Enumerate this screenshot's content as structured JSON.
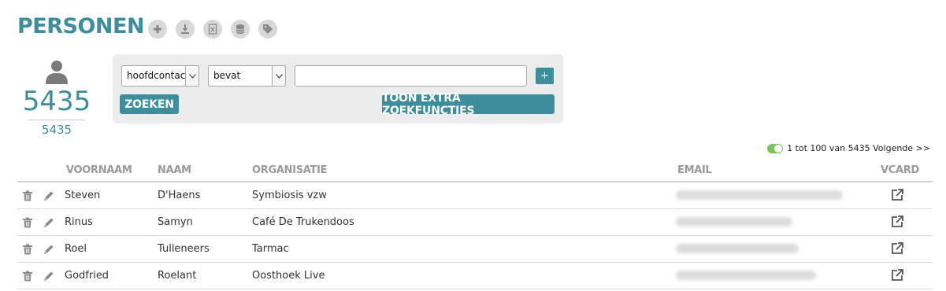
{
  "page": {
    "title": "PERSONEN"
  },
  "title_actions": [
    {
      "icon": "plus-icon"
    },
    {
      "icon": "download-icon"
    },
    {
      "icon": "excel-icon"
    },
    {
      "icon": "database-icon"
    },
    {
      "icon": "tag-icon"
    }
  ],
  "stats": {
    "icon": "person-icon",
    "total_large": "5435",
    "total_small": "5435"
  },
  "search": {
    "field_value": "hoofdcontac",
    "operator_value": "bevat",
    "input_value": "",
    "add_label": "+",
    "search_label": "ZOEKEN",
    "extra_label": "TOON EXTRA ZOEKFUNCTIES"
  },
  "pagination": {
    "text": "1 tot 100 van 5435 Volgende >>"
  },
  "table": {
    "headers": {
      "firstname": "VOORNAAM",
      "lastname": "NAAM",
      "organisation": "ORGANISATIE",
      "email": "EMAIL",
      "vcard": "VCARD"
    },
    "rows": [
      {
        "firstname": "Steven",
        "lastname": "D'Haens",
        "organisation": "Symbiosis vzw"
      },
      {
        "firstname": "Rinus",
        "lastname": "Samyn",
        "organisation": "Café De Trukendoos"
      },
      {
        "firstname": "Roel",
        "lastname": "Tulleneers",
        "organisation": "Tarmac"
      },
      {
        "firstname": "Godfried",
        "lastname": "Roelant",
        "organisation": "Oosthoek Live"
      }
    ]
  },
  "colors": {
    "accent": "#3d8d9d",
    "toggle_on": "#7cc45e",
    "panel_bg": "#ececec",
    "header_text": "#999999"
  }
}
